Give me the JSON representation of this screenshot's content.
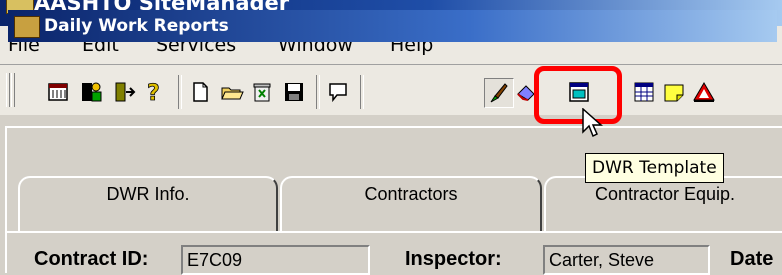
{
  "app": {
    "title": "AASHTO SiteManager"
  },
  "menu": [
    "File",
    "Edit",
    "Services",
    "Window",
    "Help"
  ],
  "toolbar": {
    "buttons": [
      "calendar-icon",
      "worker-icon",
      "exit-door-icon",
      "help-question-icon",
      "new-document-icon",
      "open-folder-icon",
      "recycle-bin-icon",
      "save-disk-icon",
      "speech-bubble-icon",
      "brush-icon",
      "eraser-icon",
      "dwr-template-icon",
      "calendar-grid-icon",
      "sticky-note-icon",
      "warning-triangle-icon"
    ]
  },
  "tooltip": {
    "text": "DWR Template"
  },
  "child_window": {
    "title": "Daily Work Reports"
  },
  "tabs": [
    "DWR Info.",
    "Contractors",
    "Contractor Equip."
  ],
  "fields": {
    "contract_id_label": "Contract ID:",
    "contract_id_value": "E7C09",
    "inspector_label": "Inspector:",
    "inspector_value": "Carter, Steve",
    "date_label": "Date"
  },
  "colors": {
    "highlight": "#ff0000",
    "titlebar": "#0a246a",
    "tooltip_bg": "#ffffe1"
  }
}
